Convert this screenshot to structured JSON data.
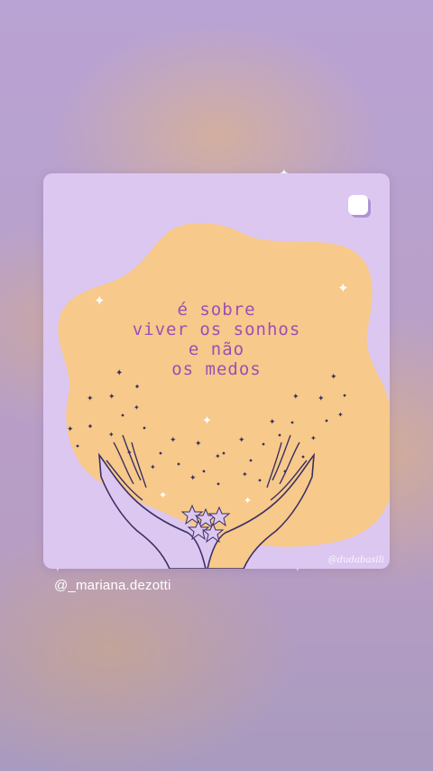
{
  "post": {
    "quote_lines": [
      "é sobre",
      "viver os sonhos",
      "e não",
      "os medos"
    ],
    "watermark": "@dudabasili",
    "share_icon": "instagram-share-icon"
  },
  "caption": {
    "username": "@_mariana.dezotti"
  },
  "colors": {
    "card_lilac": "#dcc7f1",
    "blob_peach": "#f7c98a",
    "quote_purple": "#9c4fb5",
    "line_art": "#3b2f63"
  }
}
